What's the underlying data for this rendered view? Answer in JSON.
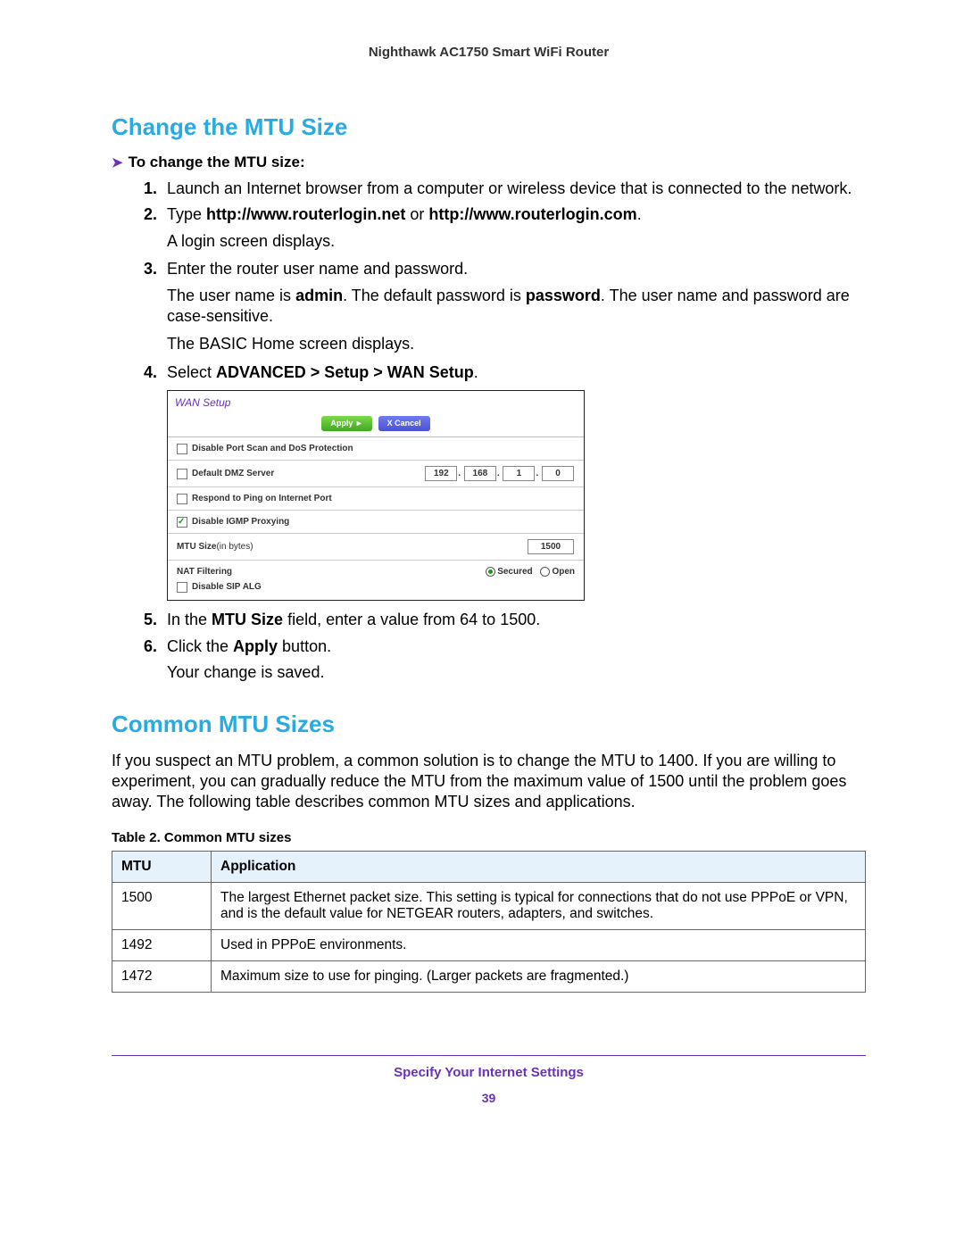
{
  "header": {
    "product": "Nighthawk AC1750 Smart WiFi Router"
  },
  "section1": {
    "title": "Change the MTU Size",
    "proc_heading": "To change the MTU size:",
    "steps": [
      {
        "n": "1.",
        "text": "Launch an Internet browser from a computer or wireless device that is connected to the network."
      },
      {
        "n": "2.",
        "pre": "Type ",
        "b1": "http://www.routerlogin.net",
        "mid": " or ",
        "b2": "http://www.routerlogin.com",
        "post": ".",
        "after": "A login screen displays."
      },
      {
        "n": "3.",
        "text": "Enter the router user name and password.",
        "p1_a": "The user name is ",
        "p1_b1": "admin",
        "p1_c": ". The default password is ",
        "p1_b2": "password",
        "p1_d": ". The user name and password are case-sensitive.",
        "p2": "The BASIC Home screen displays."
      },
      {
        "n": "4.",
        "pre": "Select ",
        "b1": "ADVANCED > Setup > WAN Setup",
        "post": "."
      },
      {
        "n": "5.",
        "pre": "In the ",
        "b1": "MTU Size",
        "post": " field, enter a value from 64 to 1500."
      },
      {
        "n": "6.",
        "pre": "Click the ",
        "b1": "Apply",
        "post": " button.",
        "after": "Your change is saved."
      }
    ]
  },
  "wan": {
    "title": "WAN Setup",
    "apply": "Apply ►",
    "cancel": "X Cancel",
    "row1": "Disable Port Scan and DoS Protection",
    "row2": "Default DMZ Server",
    "ip": [
      "192",
      "168",
      "1",
      "0"
    ],
    "row3": "Respond to Ping on Internet Port",
    "row4": "Disable IGMP Proxying",
    "row5_label": "MTU Size",
    "row5_sub": "(in bytes)",
    "mtu": "1500",
    "nat": "NAT Filtering",
    "secured": "Secured",
    "open": "Open",
    "sip": "Disable SIP ALG"
  },
  "section2": {
    "title": "Common MTU Sizes",
    "body": "If you suspect an MTU problem, a common solution is to change the MTU to 1400. If you are willing to experiment, you can gradually reduce the MTU from the maximum value of 1500 until the problem goes away. The following table describes common MTU sizes and applications.",
    "table_caption": "Table 2.  Common MTU sizes",
    "th1": "MTU",
    "th2": "Application",
    "rows": [
      {
        "mtu": "1500",
        "app": "The largest Ethernet packet size. This setting is typical for connections that do not use PPPoE or VPN, and is the default value for NETGEAR routers, adapters, and switches."
      },
      {
        "mtu": "1492",
        "app": "Used in PPPoE environments."
      },
      {
        "mtu": "1472",
        "app": "Maximum size to use for pinging. (Larger packets are fragmented.)"
      }
    ]
  },
  "footer": {
    "line1": "Specify Your Internet Settings",
    "page": "39"
  }
}
